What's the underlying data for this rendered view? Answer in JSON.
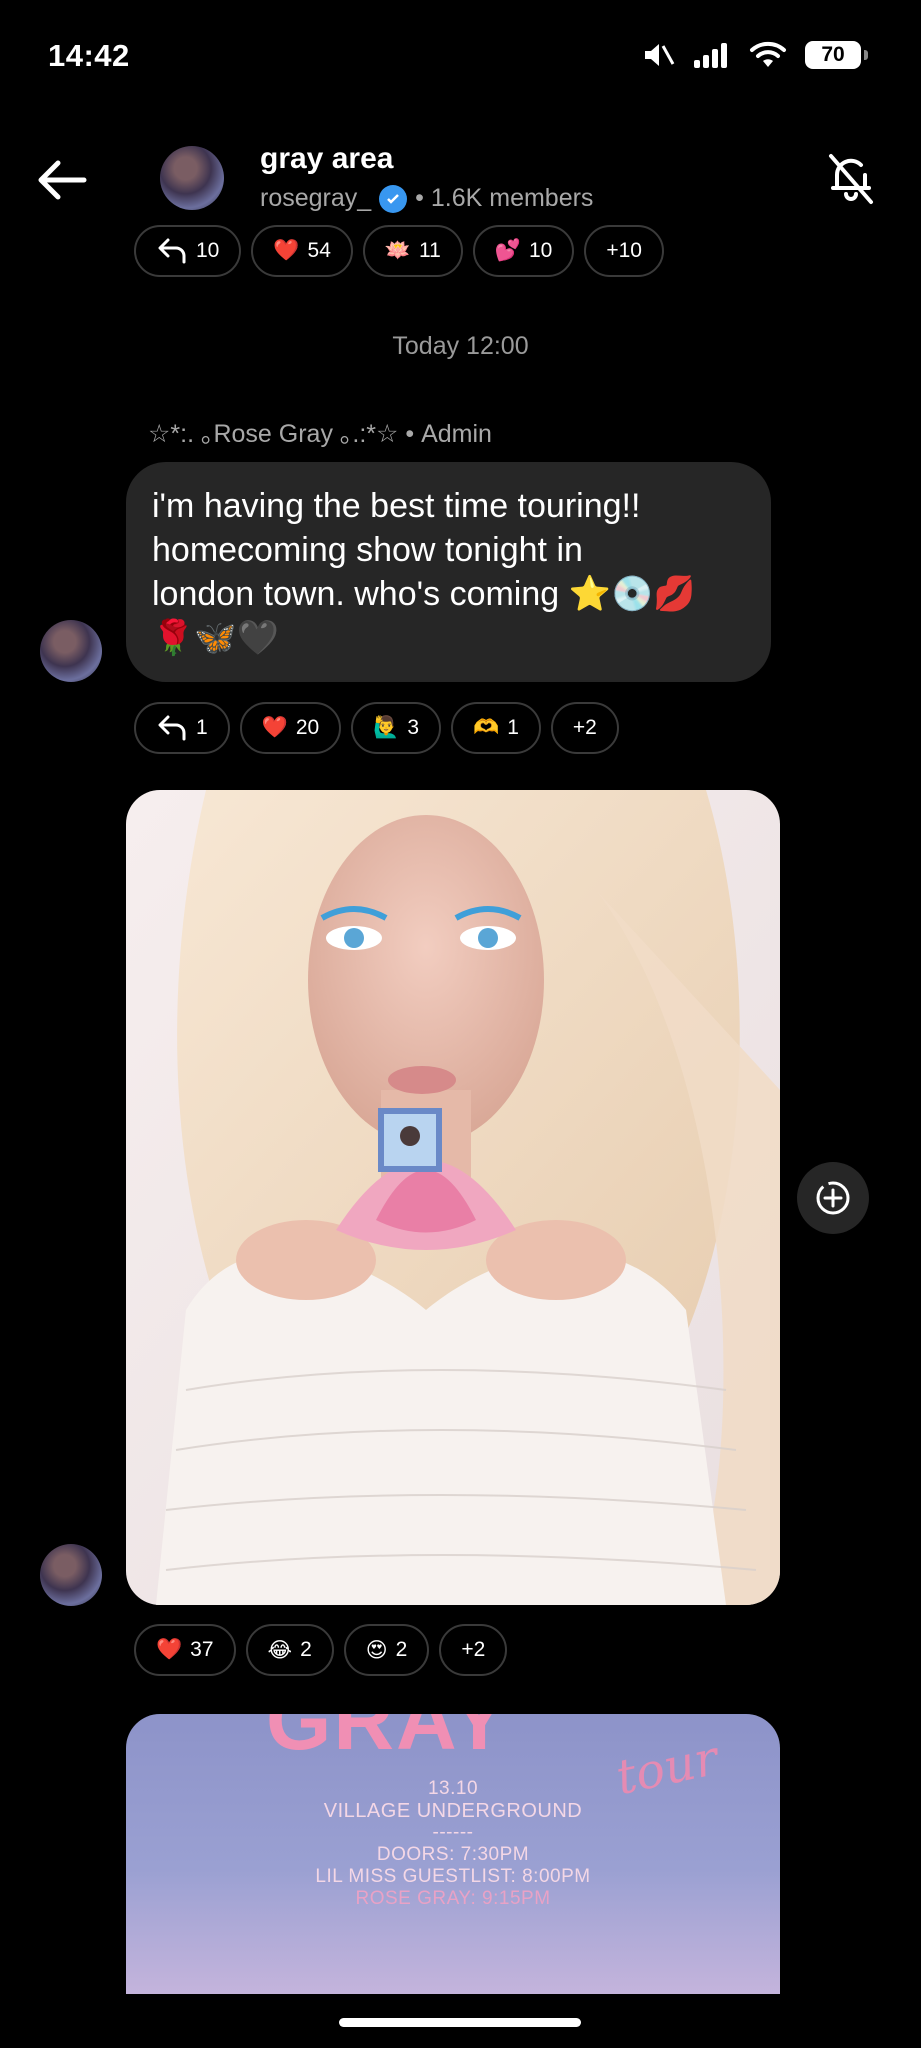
{
  "status": {
    "time": "14:42",
    "battery": "70"
  },
  "header": {
    "title": "gray area",
    "handle": "rosegray_",
    "members": "• 1.6K members"
  },
  "top_reactions": [
    {
      "icon": "reply-icon",
      "emoji": "",
      "count": "10"
    },
    {
      "icon": "heart-icon",
      "emoji": "❤️",
      "count": "54"
    },
    {
      "icon": "lotus-icon",
      "emoji": "🪷",
      "count": "11"
    },
    {
      "icon": "sparkling-heart-icon",
      "emoji": "💕",
      "count": "10"
    },
    {
      "icon": "more-reactions",
      "emoji": "",
      "count": "+10"
    }
  ],
  "date_separator": "Today 12:00",
  "message": {
    "sender": "☆*:. ｡Rose Gray ｡.:*☆ • Admin",
    "line1": "i'm having the best time touring!!",
    "line2": "homecoming show tonight in",
    "line3": "london town. who's coming ⭐💿💋",
    "line4": "🌹🦋🖤"
  },
  "msg_reactions": [
    {
      "icon": "reply-icon",
      "emoji": "",
      "count": "1"
    },
    {
      "icon": "heart-icon",
      "emoji": "❤️",
      "count": "20"
    },
    {
      "icon": "raising-hand-icon",
      "emoji": "🙋‍♂️",
      "count": "3"
    },
    {
      "icon": "heart-hands-icon",
      "emoji": "🫶",
      "count": "1"
    },
    {
      "icon": "more-reactions",
      "emoji": "",
      "count": "+2"
    }
  ],
  "photo_reactions": [
    {
      "icon": "heart-icon",
      "emoji": "❤️",
      "count": "37"
    },
    {
      "icon": "laughing-icon",
      "emoji": "😂",
      "count": "2"
    },
    {
      "icon": "heart-eyes-icon",
      "emoji": "😍",
      "count": "2"
    },
    {
      "icon": "more-reactions",
      "emoji": "",
      "count": "+2"
    }
  ],
  "poster": {
    "title": "GRAY",
    "script": "tour",
    "date": "13.10",
    "venue": "VILLAGE UNDERGROUND",
    "divider": "------",
    "doors": "DOORS: 7:30PM",
    "support": "LIL MISS GUESTLIST: 8:00PM",
    "headliner": "ROSE GRAY: 9:15PM"
  }
}
